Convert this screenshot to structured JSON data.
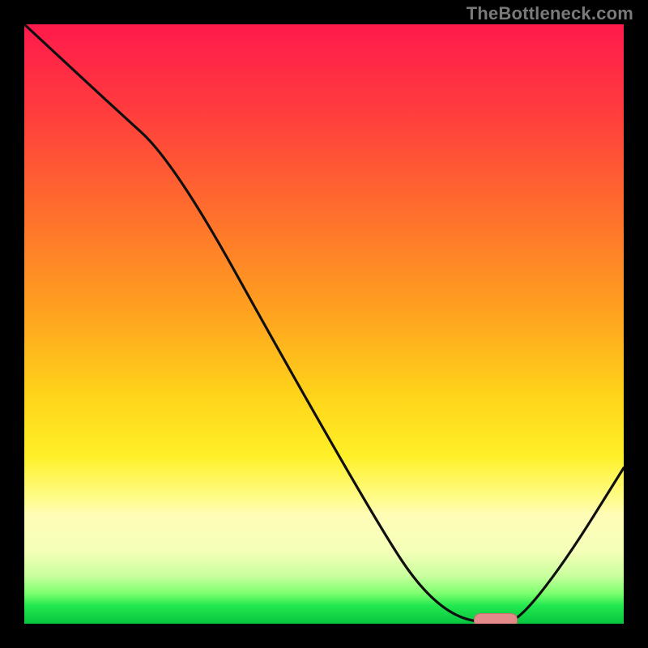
{
  "watermark": "TheBottleneck.com",
  "colors": {
    "frame_bg": "#000000",
    "gradient_top": "#ff1a4c",
    "gradient_bottom": "#07c63f",
    "curve": "#101010",
    "marker": "#e58a8a"
  },
  "chart_data": {
    "type": "line",
    "title": "",
    "xlabel": "",
    "ylabel": "",
    "xlim": [
      0,
      100
    ],
    "ylim": [
      0,
      100
    ],
    "grid": false,
    "watermark": "TheBottleneck.com",
    "series": [
      {
        "name": "bottleneck-curve",
        "x": [
          0,
          14,
          25,
          45,
          60,
          66,
          72,
          78,
          82,
          90,
          100
        ],
        "values": [
          100,
          87,
          77,
          41,
          15,
          6,
          1,
          0,
          0,
          10,
          26
        ]
      }
    ],
    "markers": [
      {
        "name": "optimal-range",
        "x_start": 75,
        "x_end": 82,
        "y": 0.7
      }
    ],
    "axis_ticks": {
      "x": [],
      "y": []
    },
    "legend": false
  }
}
